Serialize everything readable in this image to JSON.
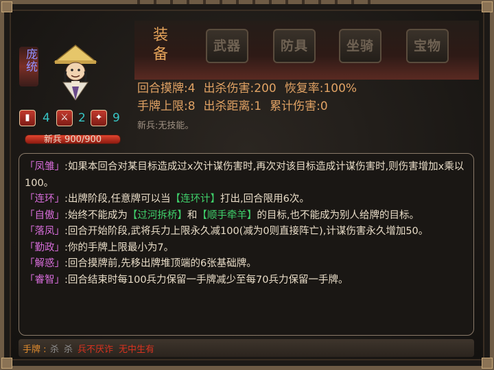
{
  "hero": {
    "name": "庞统",
    "hp_text": "新兵 900/900",
    "stats": [
      {
        "icon": "card-icon",
        "value": "4",
        "color": "#37c6c6"
      },
      {
        "icon": "sword-icon",
        "value": "2",
        "color": "#37c6c6"
      },
      {
        "icon": "armor-icon",
        "value": "9",
        "color": "#37c6c6"
      }
    ],
    "hp_fraction": 1.0
  },
  "equipment": {
    "label": "装备",
    "slots": [
      "武器",
      "防具",
      "坐骑",
      "宝物"
    ]
  },
  "info": {
    "row1": [
      "回合摸牌:4",
      "出杀伤害:200",
      "恢复率:100%"
    ],
    "row2": [
      "手牌上限:8",
      "出杀距离:1",
      "累计伤害:0"
    ],
    "note": "新兵:无技能。"
  },
  "skills": [
    {
      "name": "「凤雏」",
      "segments": [
        {
          "t": ":如果本回合对某目标造成过x次计谋伤害时,再次对该目标造成计谋伤害时,则伤害增加x乘以100。",
          "hl": false
        }
      ]
    },
    {
      "name": "「连环」",
      "segments": [
        {
          "t": ":出牌阶段,任意牌可以当",
          "hl": false
        },
        {
          "t": "【连环计】",
          "hl": true
        },
        {
          "t": "打出,回合限用6次。",
          "hl": false
        }
      ]
    },
    {
      "name": "「自傲」",
      "segments": [
        {
          "t": ":始终不能成为",
          "hl": false
        },
        {
          "t": "【过河拆桥】",
          "hl": true
        },
        {
          "t": "和",
          "hl": false
        },
        {
          "t": "【顺手牵羊】",
          "hl": true
        },
        {
          "t": "的目标,也不能成为别人给牌的目标。",
          "hl": false
        }
      ]
    },
    {
      "name": "「落凤」",
      "segments": [
        {
          "t": ":回合开始阶段,武将兵力上限永久减100(减为0则直接阵亡),计谋伤害永久增加50。",
          "hl": false
        }
      ]
    },
    {
      "name": "「勤政」",
      "segments": [
        {
          "t": ":你的手牌上限最小为7。",
          "hl": false
        }
      ]
    },
    {
      "name": "「解惑」",
      "segments": [
        {
          "t": ":回合摸牌前,先移出牌堆顶端的6张基础牌。",
          "hl": false
        }
      ]
    },
    {
      "name": "「睿智」",
      "segments": [
        {
          "t": ":回合结束时每100兵力保留一手牌减少至每70兵力保留一手牌。",
          "hl": false
        }
      ]
    }
  ],
  "hand": {
    "label": "手牌 :",
    "cards": [
      {
        "text": "杀",
        "color": "#8c8c8c"
      },
      {
        "text": "杀",
        "color": "#8c8c8c"
      },
      {
        "text": "兵不厌诈",
        "color": "#d8321f"
      },
      {
        "text": "无中生有",
        "color": "#d8321f"
      }
    ]
  }
}
